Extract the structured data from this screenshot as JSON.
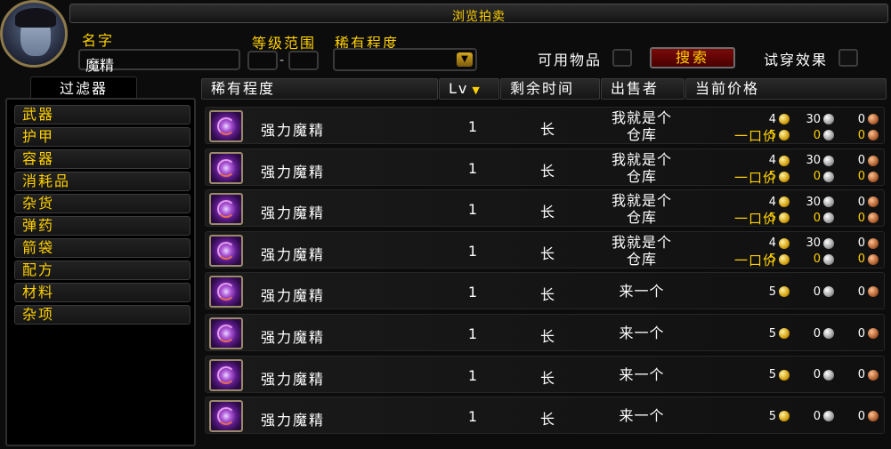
{
  "window": {
    "title": "浏览拍卖"
  },
  "search": {
    "name_label": "名字",
    "name_value": "魔精",
    "level_range_label": "等级范围",
    "level_min": "",
    "level_max": "",
    "rarity_label": "稀有程度",
    "rarity_value": "",
    "usable_label": "可用物品",
    "search_button": "搜索",
    "preview_label": "试穿效果"
  },
  "filters": {
    "tab_label": "过滤器",
    "items": [
      "武器",
      "护甲",
      "容器",
      "消耗品",
      "杂货",
      "弹药",
      "箭袋",
      "配方",
      "材料",
      "杂项"
    ]
  },
  "columns": {
    "rarity": "稀有程度",
    "level": "Lv",
    "time_left": "剩余时间",
    "seller": "出售者",
    "price": "当前价格"
  },
  "buyout_label": "一口价",
  "rows": [
    {
      "item": "强力魔精",
      "level": "1",
      "time": "长",
      "seller_line1": "我就是个",
      "seller_line2": "仓库",
      "bid": {
        "gold": "4",
        "silver": "30",
        "copper": "0"
      },
      "buyout": {
        "gold": "5",
        "silver": "0",
        "copper": "0"
      }
    },
    {
      "item": "强力魔精",
      "level": "1",
      "time": "长",
      "seller_line1": "我就是个",
      "seller_line2": "仓库",
      "bid": {
        "gold": "4",
        "silver": "30",
        "copper": "0"
      },
      "buyout": {
        "gold": "5",
        "silver": "0",
        "copper": "0"
      }
    },
    {
      "item": "强力魔精",
      "level": "1",
      "time": "长",
      "seller_line1": "我就是个",
      "seller_line2": "仓库",
      "bid": {
        "gold": "4",
        "silver": "30",
        "copper": "0"
      },
      "buyout": {
        "gold": "5",
        "silver": "0",
        "copper": "0"
      }
    },
    {
      "item": "强力魔精",
      "level": "1",
      "time": "长",
      "seller_line1": "我就是个",
      "seller_line2": "仓库",
      "bid": {
        "gold": "4",
        "silver": "30",
        "copper": "0"
      },
      "buyout": {
        "gold": "5",
        "silver": "0",
        "copper": "0"
      }
    },
    {
      "item": "强力魔精",
      "level": "1",
      "time": "长",
      "seller_line1": "来一个",
      "seller_line2": "",
      "bid": {
        "gold": "5",
        "silver": "0",
        "copper": "0"
      },
      "buyout": null
    },
    {
      "item": "强力魔精",
      "level": "1",
      "time": "长",
      "seller_line1": "来一个",
      "seller_line2": "",
      "bid": {
        "gold": "5",
        "silver": "0",
        "copper": "0"
      },
      "buyout": null
    },
    {
      "item": "强力魔精",
      "level": "1",
      "time": "长",
      "seller_line1": "来一个",
      "seller_line2": "",
      "bid": {
        "gold": "5",
        "silver": "0",
        "copper": "0"
      },
      "buyout": null
    },
    {
      "item": "强力魔精",
      "level": "1",
      "time": "长",
      "seller_line1": "来一个",
      "seller_line2": "",
      "bid": {
        "gold": "5",
        "silver": "0",
        "copper": "0"
      },
      "buyout": null
    }
  ]
}
